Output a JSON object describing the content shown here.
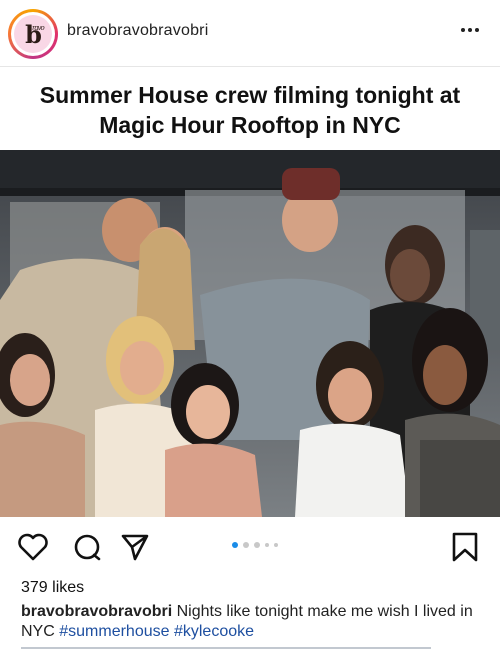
{
  "post": {
    "username": "bravobravobravobri",
    "more_icon": "more-horizontal-icon",
    "avatar_text": "b",
    "avatar_small_text": "ravo"
  },
  "headline": {
    "line1": "Summer House crew filming tonight at",
    "line2": "Magic Hour Rooftop in NYC"
  },
  "actions": {
    "like_icon": "heart-icon",
    "comment_icon": "comment-icon",
    "share_icon": "send-icon",
    "save_icon": "bookmark-icon",
    "carousel_position": 1,
    "carousel_dots": 5
  },
  "engagement": {
    "likes": "379 likes"
  },
  "caption": {
    "username": "bravobravobravobri",
    "text": " Nights like tonight make me wish I lived in NYC ",
    "tag1": "#summerhouse",
    "tag2": " #kylecooke"
  },
  "colors": {
    "accent_link": "#1e4fa0",
    "carousel_active": "#1a8ce8",
    "avatar_bg": "#f9d7e6"
  }
}
